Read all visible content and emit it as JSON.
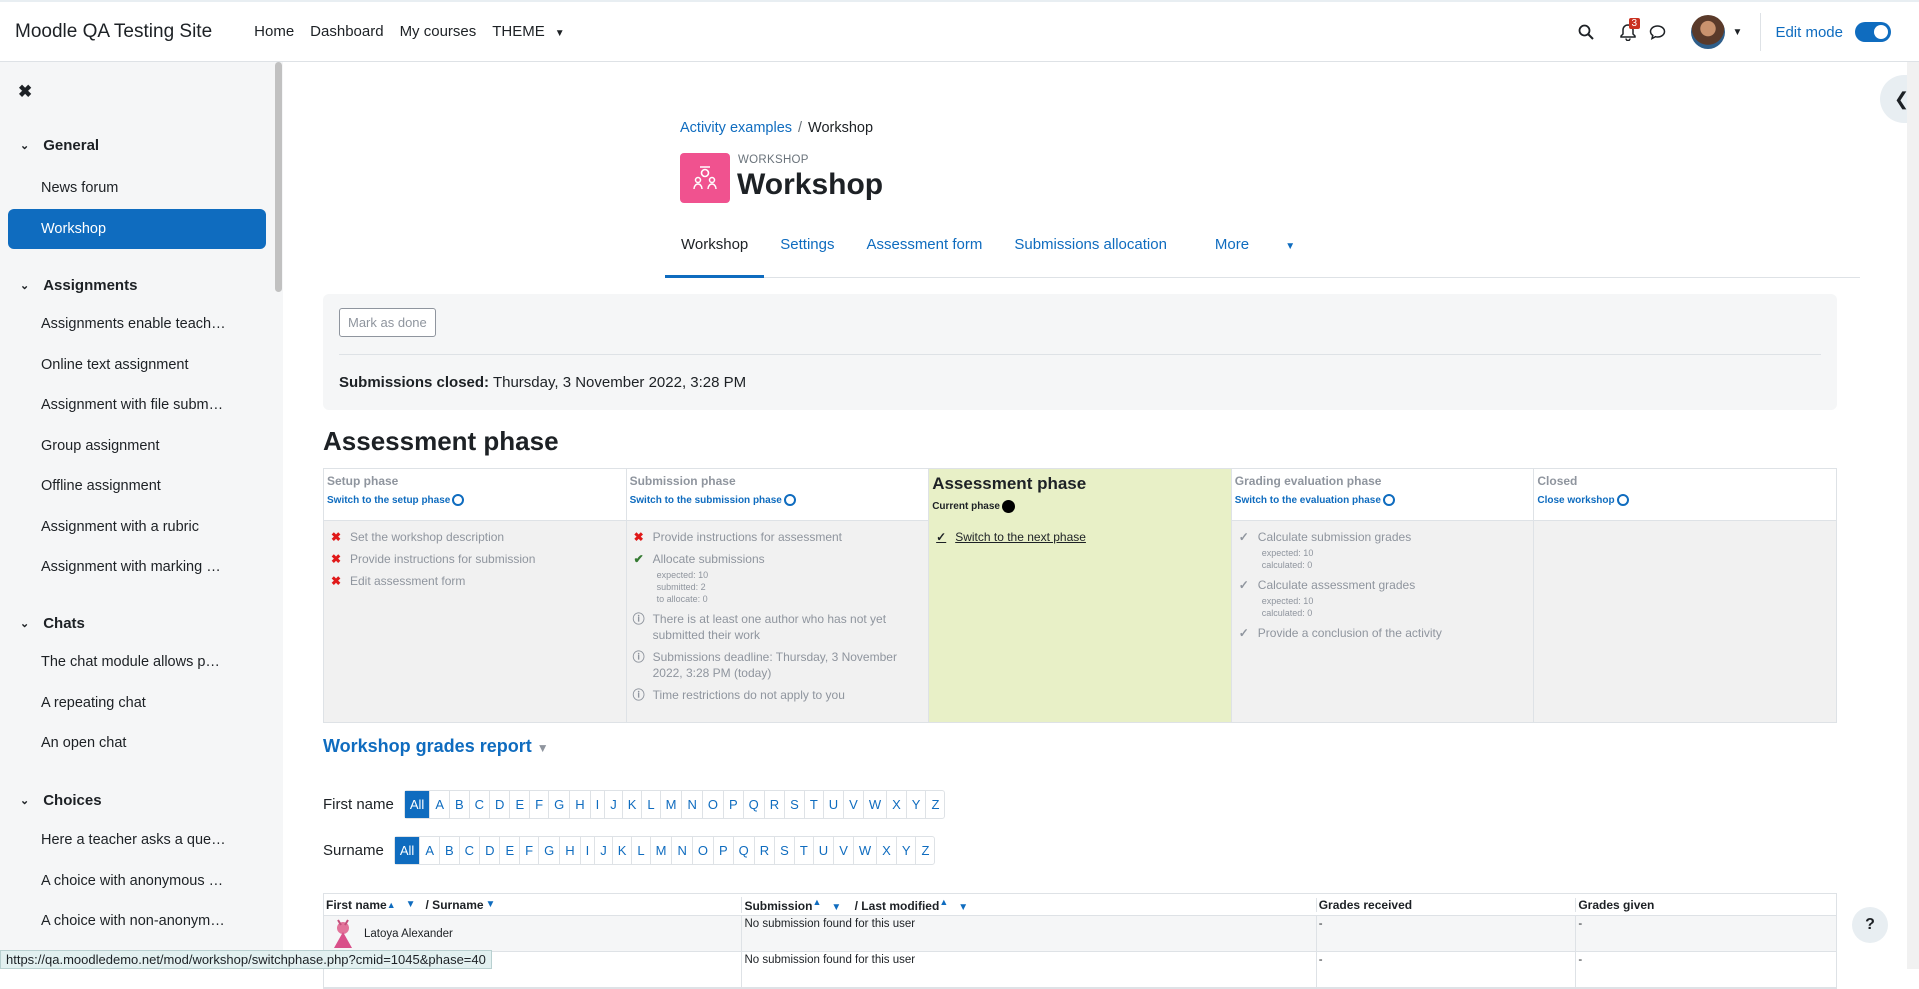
{
  "site": {
    "name": "Moodle QA Testing Site"
  },
  "topnav": [
    {
      "label": "Home"
    },
    {
      "label": "Dashboard"
    },
    {
      "label": "My courses"
    },
    {
      "label": "THEME"
    }
  ],
  "notifications": {
    "count": "3"
  },
  "edit_mode": {
    "label": "Edit mode",
    "on": true
  },
  "sidebar": {
    "sections": [
      {
        "title": "General",
        "items": [
          "News forum",
          "Workshop"
        ]
      },
      {
        "title": "Assignments",
        "items": [
          "Assignments enable teach…",
          "Online text assignment",
          "Assignment with file subm…",
          "Group assignment",
          "Offline assignment",
          "Assignment with a rubric",
          "Assignment with marking …"
        ]
      },
      {
        "title": "Chats",
        "items": [
          "The chat module allows p…",
          "A repeating chat",
          "An open chat"
        ]
      },
      {
        "title": "Choices",
        "items": [
          "Here a teacher asks a que…",
          "A choice with anonymous …",
          "A choice with non-anonym…"
        ]
      }
    ],
    "active": "Workshop"
  },
  "breadcrumb": {
    "parent": "Activity examples",
    "separator": "/",
    "current": "Workshop"
  },
  "activity": {
    "type_label": "WORKSHOP",
    "title": "Workshop"
  },
  "tabs": [
    {
      "label": "Workshop"
    },
    {
      "label": "Settings"
    },
    {
      "label": "Assessment form"
    },
    {
      "label": "Submissions allocation"
    },
    {
      "label": "More"
    }
  ],
  "completion": {
    "mark_label": "Mark as done",
    "closed_label": "Submissions closed:",
    "closed_value": "Thursday, 3 November 2022, 3:28 PM"
  },
  "phase_heading": "Assessment phase",
  "phases": [
    {
      "name": "Setup phase",
      "switch": "Switch to the setup phase",
      "tasks": [
        {
          "status": "fail",
          "text": "Set the workshop description"
        },
        {
          "status": "fail",
          "text": "Provide instructions for submission"
        },
        {
          "status": "fail",
          "text": "Edit assessment form"
        }
      ]
    },
    {
      "name": "Submission phase",
      "switch": "Switch to the submission phase",
      "tasks": [
        {
          "status": "fail",
          "text": "Provide instructions for assessment"
        },
        {
          "status": "done",
          "text": "Allocate submissions",
          "details": [
            "expected: 10",
            "submitted: 2",
            "to allocate: 0"
          ]
        },
        {
          "status": "info",
          "text": "There is at least one author who has not yet submitted their work"
        },
        {
          "status": "info",
          "text": "Submissions deadline: Thursday, 3 November 2022, 3:28 PM (today)"
        },
        {
          "status": "info",
          "text": "Time restrictions do not apply to you"
        }
      ]
    },
    {
      "name": "Assessment phase",
      "switch": "Current phase",
      "current": true,
      "tasks": [
        {
          "status": "todo",
          "text": "Switch to the next phase",
          "link": true
        }
      ]
    },
    {
      "name": "Grading evaluation phase",
      "switch": "Switch to the evaluation phase",
      "tasks": [
        {
          "status": "todo",
          "text": "Calculate submission grades",
          "details": [
            "expected: 10",
            "calculated: 0"
          ]
        },
        {
          "status": "todo",
          "text": "Calculate assessment grades",
          "details": [
            "expected: 10",
            "calculated: 0"
          ]
        },
        {
          "status": "todo",
          "text": "Provide a conclusion of the activity"
        }
      ]
    },
    {
      "name": "Closed",
      "switch": "Close workshop",
      "tasks": []
    }
  ],
  "report": {
    "title": "Workshop grades report",
    "firstname_label": "First name",
    "surname_label": "Surname",
    "letters": [
      "All",
      "A",
      "B",
      "C",
      "D",
      "E",
      "F",
      "G",
      "H",
      "I",
      "J",
      "K",
      "L",
      "M",
      "N",
      "O",
      "P",
      "Q",
      "R",
      "S",
      "T",
      "U",
      "V",
      "W",
      "X",
      "Y",
      "Z"
    ],
    "headers": {
      "first_name": "First name",
      "surname": "/ Surname",
      "submission": "Submission",
      "last_modified": "/ Last modified",
      "grades_received": "Grades received",
      "grades_given": "Grades given"
    },
    "rows": [
      {
        "name": "Latoya Alexander",
        "submission": "No submission found for this user",
        "received": "-",
        "given": "-"
      },
      {
        "name": "",
        "submission": "No submission found for this user",
        "received": "-",
        "given": "-"
      }
    ]
  },
  "statusbar": {
    "url": "https://qa.moodledemo.net/mod/workshop/switchphase.php?cmid=1045&phase=40"
  }
}
